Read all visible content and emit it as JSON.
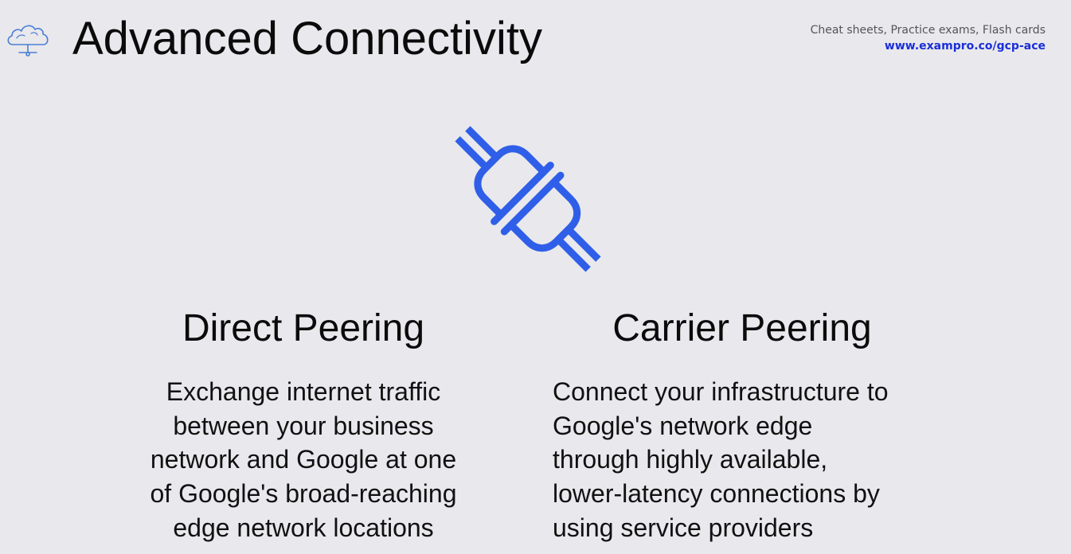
{
  "header": {
    "title": "Advanced Connectivity",
    "logo_icon": "cloud-network-icon"
  },
  "promo": {
    "tagline": "Cheat sheets, Practice exams, Flash cards",
    "link": "www.exampro.co/gcp-ace",
    "link_color": "#1a2fd8"
  },
  "hero": {
    "icon": "plug-connector-icon",
    "icon_color": "#2f5fe8"
  },
  "columns": [
    {
      "heading": "Direct Peering",
      "body": "Exchange internet traffic\nbetween your business\nnetwork and Google at one\nof Google's broad-reaching\nedge network locations"
    },
    {
      "heading": "Carrier Peering",
      "body": "Connect your infrastructure to\nGoogle's network edge\nthrough highly available,\nlower-latency connections by\nusing service providers"
    }
  ],
  "colors": {
    "background": "#e9e8ec",
    "text": "#111111",
    "logo_stroke": "#4a7fd4"
  }
}
